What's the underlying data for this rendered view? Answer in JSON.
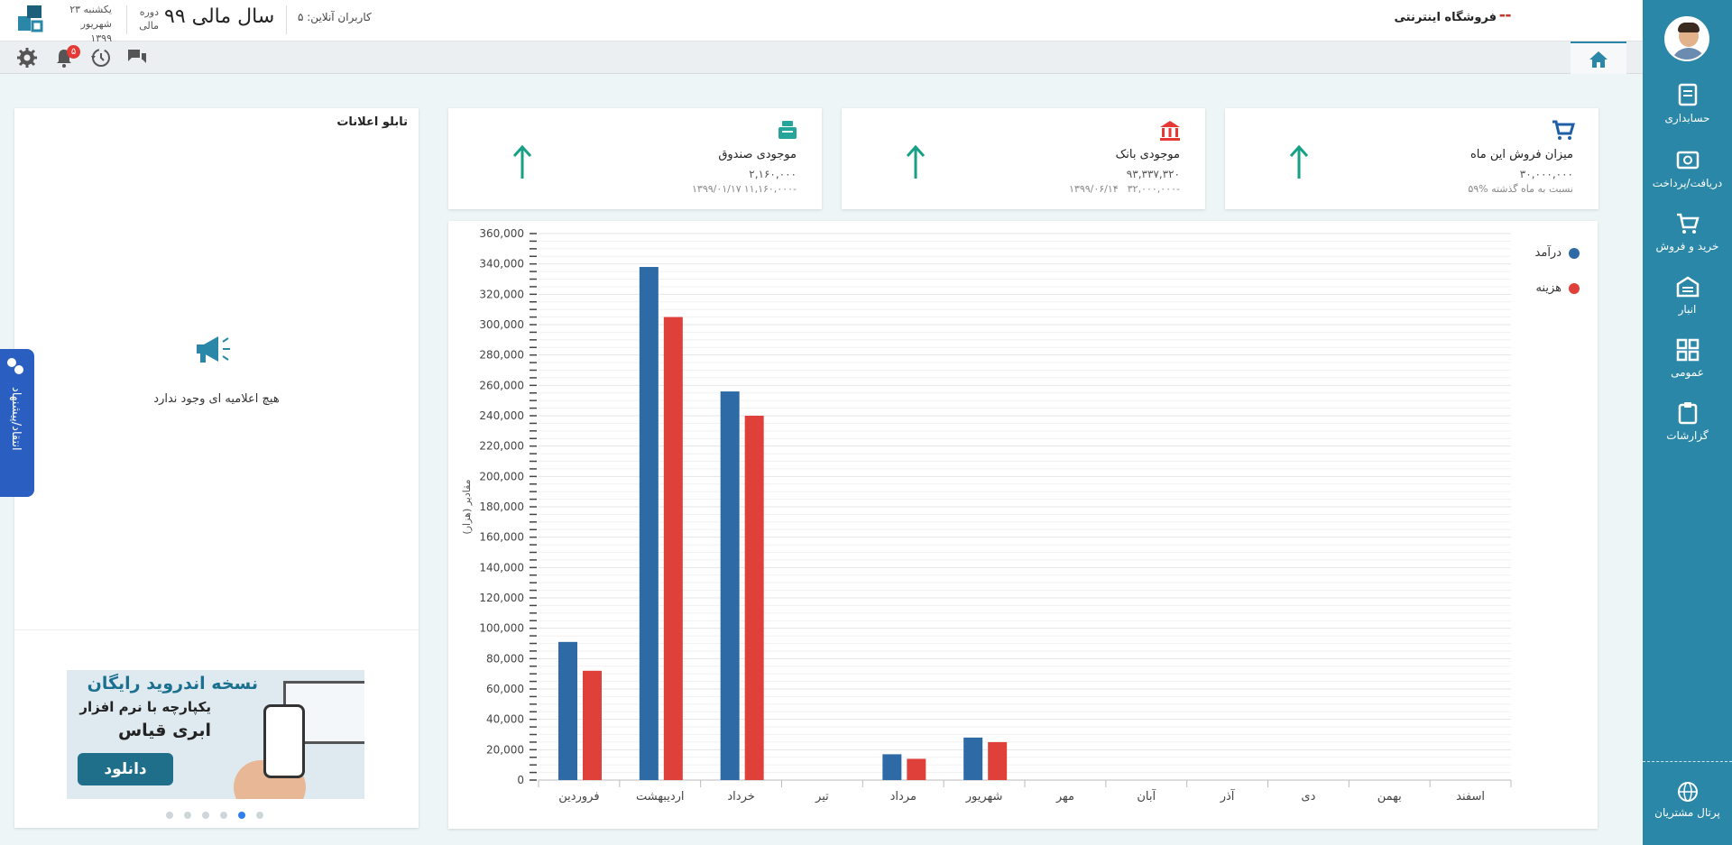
{
  "header": {
    "shop_name": "فروشگاه اینترنتی",
    "fiscal_year": "سال مالی ۹۹",
    "online_users": "کاربران آنلاین: ۵",
    "period_label": "دوره مالی",
    "date_line1": "یکشنبه ۲۳",
    "date_line2": "شهریور ۱۳۹۹"
  },
  "toolbar": {
    "notification_count": "۵"
  },
  "sidebar": {
    "items": [
      {
        "label": "حسابداری",
        "icon": "accounting-icon"
      },
      {
        "label": "دریافت/پرداخت",
        "icon": "payment-icon"
      },
      {
        "label": "خرید و فروش",
        "icon": "cart-icon"
      },
      {
        "label": "انبار",
        "icon": "warehouse-icon"
      },
      {
        "label": "عمومی",
        "icon": "general-icon"
      },
      {
        "label": "گزارشات",
        "icon": "reports-icon"
      }
    ],
    "portal_label": "پرتال مشتریان"
  },
  "cards": [
    {
      "title": "میزان فروش این ماه",
      "value": "۳۰,۰۰۰,۰۰۰",
      "sub": "۵۹%  نسبت به ماه گذشته",
      "sub2": "",
      "icon_color": "#1f5fa8"
    },
    {
      "title": "موجودی بانک",
      "value": "۹۳,۳۳۷,۳۲۰",
      "sub": "۳۲,۰۰۰,۰۰۰-",
      "sub2": "۱۳۹۹/۰۶/۱۴",
      "icon_color": "#e53935"
    },
    {
      "title": "موجودی صندوق",
      "value": "۲,۱۶۰,۰۰۰",
      "sub": "۱۱,۱۶۰,۰۰۰-",
      "sub2": "۱۳۹۹/۰۱/۱۷",
      "icon_color": "#26a69a"
    }
  ],
  "notice": {
    "title": "تابلو اعلانات",
    "empty_text": "هیچ اعلامیه ای وجود ندارد",
    "banner_line1": "نسخه اندروید رایگان",
    "banner_line2": "یکپارچه با نرم افزار",
    "banner_line3": "ابری قیاس",
    "banner_button": "دانلود"
  },
  "feedback_label": "انتقاد/پیشنهاد",
  "chart_data": {
    "type": "bar",
    "categories": [
      "فروردین",
      "اردیبهشت",
      "خرداد",
      "تیر",
      "مرداد",
      "شهریور",
      "مهر",
      "آبان",
      "آذر",
      "دی",
      "بهمن",
      "اسفند"
    ],
    "series": [
      {
        "name": "درآمد",
        "color": "#2e6aa6",
        "values": [
          91000,
          338000,
          256000,
          0,
          17000,
          28000,
          0,
          0,
          0,
          0,
          0,
          0
        ]
      },
      {
        "name": "هزینه",
        "color": "#e0403a",
        "values": [
          72000,
          305000,
          240000,
          0,
          14000,
          25000,
          0,
          0,
          0,
          0,
          0,
          0
        ]
      }
    ],
    "ylabel": "مقادیر (هزار)",
    "ylim": [
      0,
      360000
    ],
    "yticks": [
      "0",
      "20,000",
      "40,000",
      "60,000",
      "80,000",
      "100,000",
      "120,000",
      "140,000",
      "160,000",
      "180,000",
      "200,000",
      "220,000",
      "240,000",
      "260,000",
      "280,000",
      "300,000",
      "320,000",
      "340,000",
      "360,000"
    ],
    "grid": true,
    "legend_position": "top-right"
  }
}
